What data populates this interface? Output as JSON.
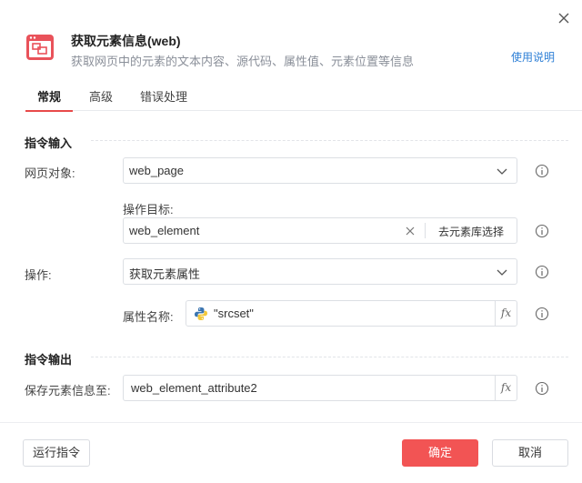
{
  "header": {
    "title": "获取元素信息(web)",
    "subtitle": "获取网页中的元素的文本内容、源代码、属性值、元素位置等信息",
    "help_link": "使用说明"
  },
  "tabs": [
    {
      "label": "常规",
      "active": true
    },
    {
      "label": "高级",
      "active": false
    },
    {
      "label": "错误处理",
      "active": false
    }
  ],
  "input_section": {
    "title": "指令输入",
    "web_object": {
      "label": "网页对象:",
      "value": "web_page"
    },
    "target": {
      "label": "操作目标:",
      "value": "web_element",
      "library_button": "去元素库选择"
    },
    "operation": {
      "label": "操作:",
      "value": "获取元素属性"
    },
    "attribute": {
      "label": "属性名称:",
      "value": "\"srcset\""
    }
  },
  "output_section": {
    "title": "指令输出",
    "save_to": {
      "label": "保存元素信息至:",
      "value": "web_element_attribute2"
    }
  },
  "footer": {
    "run_button": "运行指令",
    "confirm_button": "确定",
    "cancel_button": "取消"
  },
  "colors": {
    "accent": "#f25454",
    "link": "#2d7fd6",
    "tab_underline": "#e84a4a"
  },
  "icons": {
    "close": "close-icon",
    "header": "browser-element-icon",
    "info": "info-icon",
    "chevron": "chevron-down-icon",
    "python": "python-icon",
    "clear": "clear-icon",
    "fx": "fx-icon"
  },
  "fx_label": "fx"
}
